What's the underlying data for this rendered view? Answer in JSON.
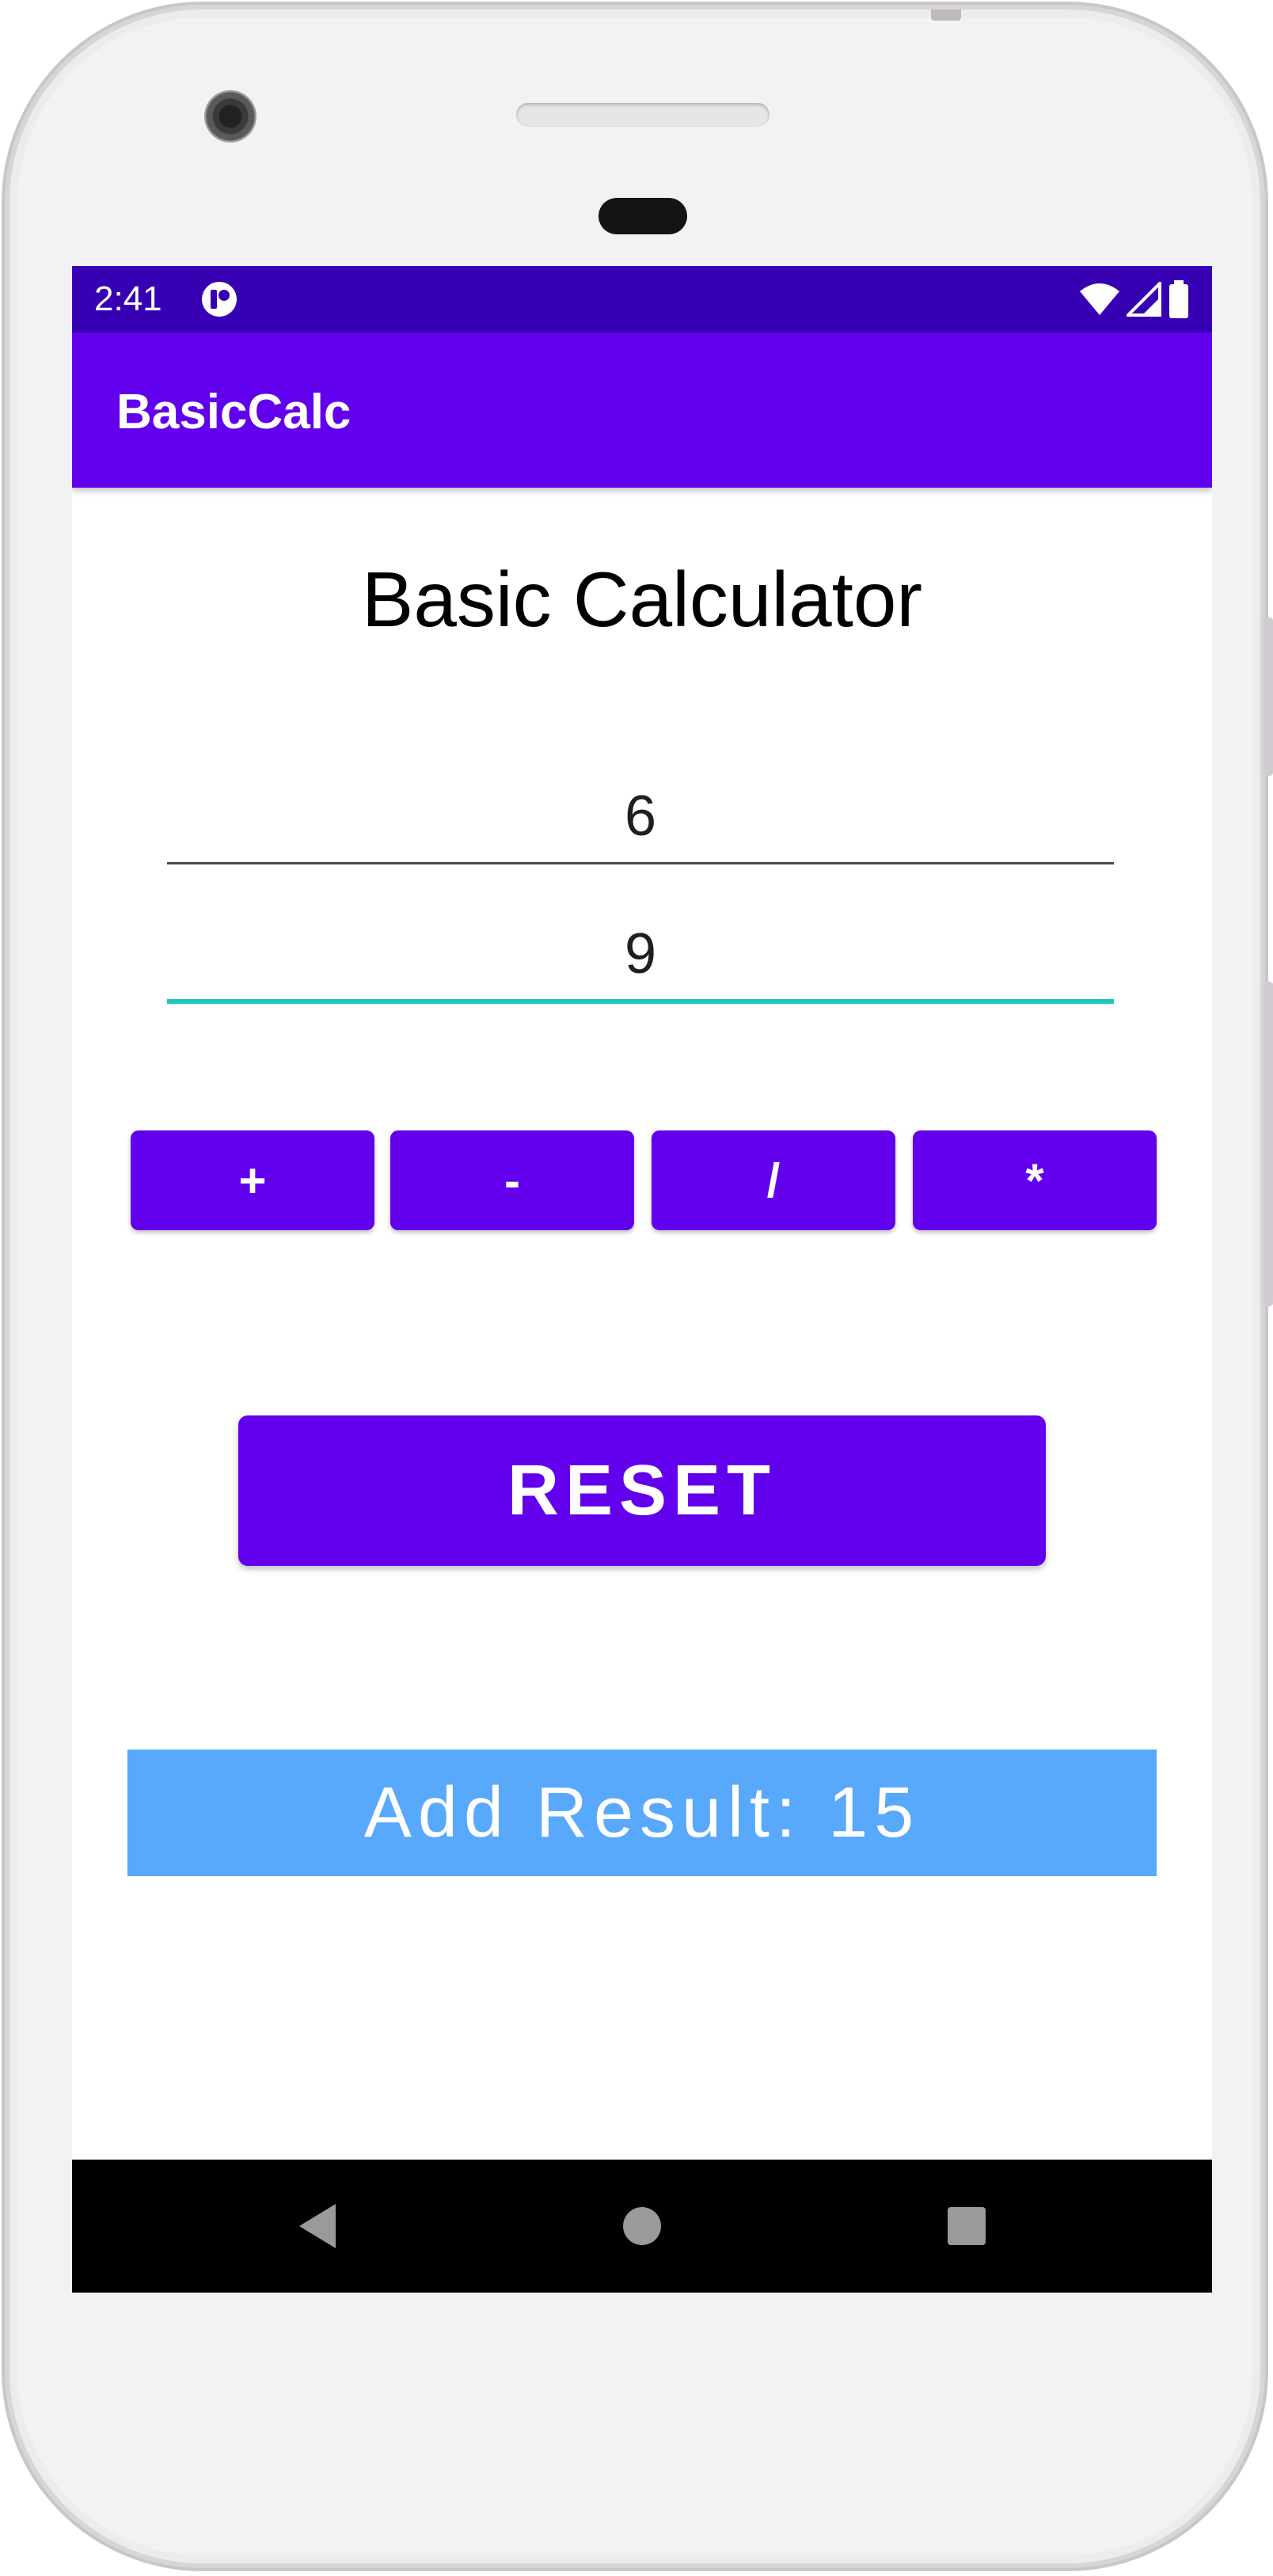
{
  "status_bar": {
    "time": "2:41",
    "icons": [
      "app-notification-icon",
      "wifi-icon",
      "cell-signal-icon",
      "battery-icon"
    ]
  },
  "app_bar": {
    "title": "BasicCalc"
  },
  "main": {
    "heading": "Basic Calculator",
    "input_1_value": "6",
    "input_2_value": "9",
    "operations": {
      "add": "+",
      "subtract": "-",
      "divide": "/",
      "multiply": "*"
    },
    "reset_label": "RESET",
    "result_text": "Add Result: 15"
  },
  "nav_bar": {
    "icons": [
      "back-icon",
      "home-icon",
      "recents-icon"
    ]
  },
  "colors": {
    "status_bar": "#3700b3",
    "primary": "#6200ee",
    "result_background": "#58a8fb",
    "focused_underline": "#1ec8b8"
  }
}
